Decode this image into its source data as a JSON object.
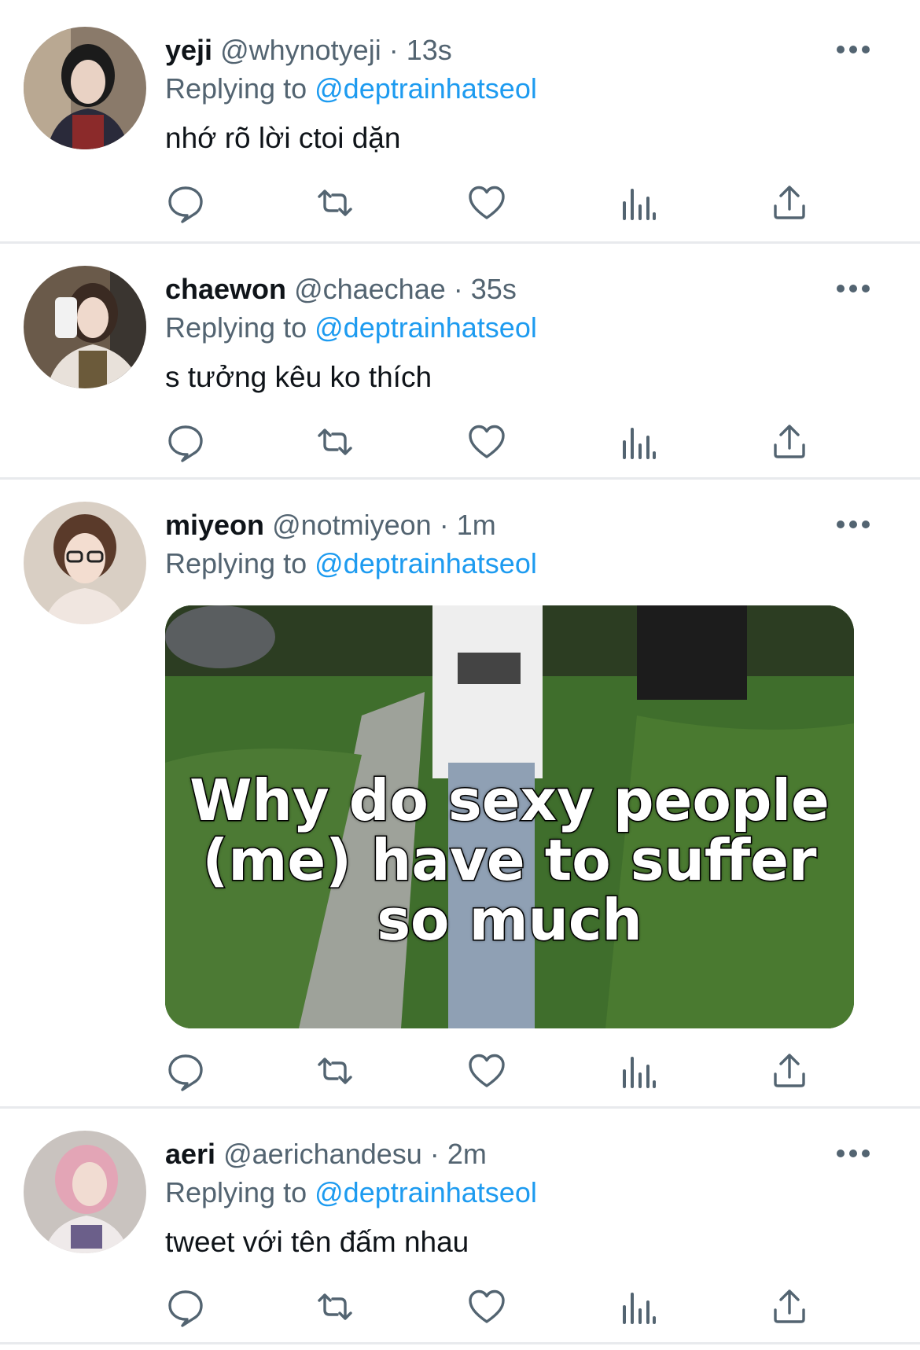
{
  "colors": {
    "name": "#0f1419",
    "secondary": "#536471",
    "link": "#1d9bf0",
    "divider": "#e8eaed"
  },
  "tweets": [
    {
      "name": "yeji",
      "handle": "@whynotyeji",
      "sep": "·",
      "time": "13s",
      "replying_prefix": "Replying to",
      "replying_to": "@deptrainhatseol",
      "text": "nhớ rõ lời ctoi dặn"
    },
    {
      "name": "chaewon",
      "handle": "@chaechae",
      "sep": "·",
      "time": "35s",
      "replying_prefix": "Replying to",
      "replying_to": "@deptrainhatseol",
      "text": "s tưởng kêu ko thích"
    },
    {
      "name": "miyeon",
      "handle": "@notmiyeon",
      "sep": "·",
      "time": "1m",
      "replying_prefix": "Replying to",
      "replying_to": "@deptrainhatseol",
      "media_caption_lines": [
        "Why do sexy people",
        "(me) have to suffer",
        "so much"
      ]
    },
    {
      "name": "aeri",
      "handle": "@aerichandesu",
      "sep": "·",
      "time": "2m",
      "replying_prefix": "Replying to",
      "replying_to": "@deptrainhatseol",
      "text": "tweet với tên đấm nhau"
    }
  ],
  "icons": {
    "reply": "reply-icon",
    "retweet": "retweet-icon",
    "like": "heart-icon",
    "views": "views-icon",
    "share": "share-icon",
    "more": "more-icon"
  }
}
